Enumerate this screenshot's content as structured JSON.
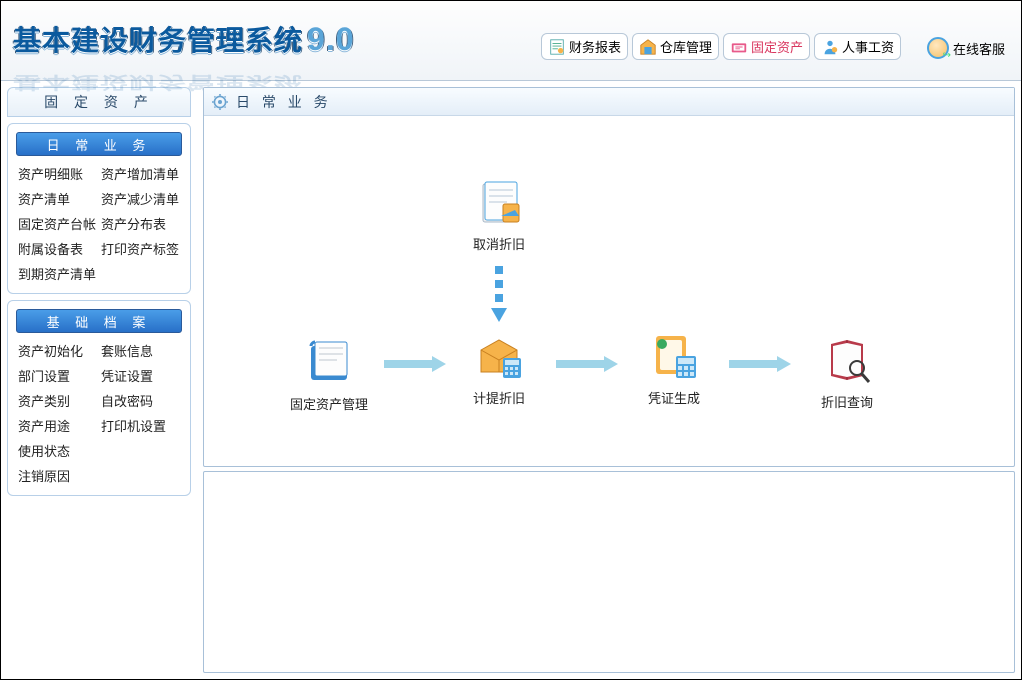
{
  "app": {
    "title": "基本建设财务管理系统",
    "version": "9.0"
  },
  "topButtons": [
    {
      "label": "财务报表",
      "icon": "report-icon",
      "active": false
    },
    {
      "label": "仓库管理",
      "icon": "warehouse-icon",
      "active": false
    },
    {
      "label": "固定资产",
      "icon": "asset-icon",
      "active": true
    },
    {
      "label": "人事工资",
      "icon": "hr-icon",
      "active": false
    }
  ],
  "service": {
    "label": "在线客服"
  },
  "sidebar": {
    "panel_title": "固 定 资 产",
    "section1": {
      "header": "日 常 业 务",
      "col1": [
        "资产明细账",
        "资产清单",
        "固定资产台帐",
        "附属设备表",
        "到期资产清单"
      ],
      "col2": [
        "资产增加清单",
        "资产减少清单",
        "资产分布表",
        "打印资产标签"
      ]
    },
    "section2": {
      "header": "基 础 档 案",
      "col1": [
        "资产初始化",
        "部门设置",
        "资产类别",
        "资产用途",
        "使用状态",
        "注销原因"
      ],
      "col2": [
        "套账信息",
        "凭证设置",
        "自改密码",
        "打印机设置"
      ]
    }
  },
  "main": {
    "panel_title": "日 常 业 务",
    "nodes": {
      "top": {
        "label": "取消折旧"
      },
      "n0": {
        "label": "固定资产管理"
      },
      "n1": {
        "label": "计提折旧"
      },
      "n2": {
        "label": "凭证生成"
      },
      "n3": {
        "label": "折旧查询"
      }
    }
  }
}
